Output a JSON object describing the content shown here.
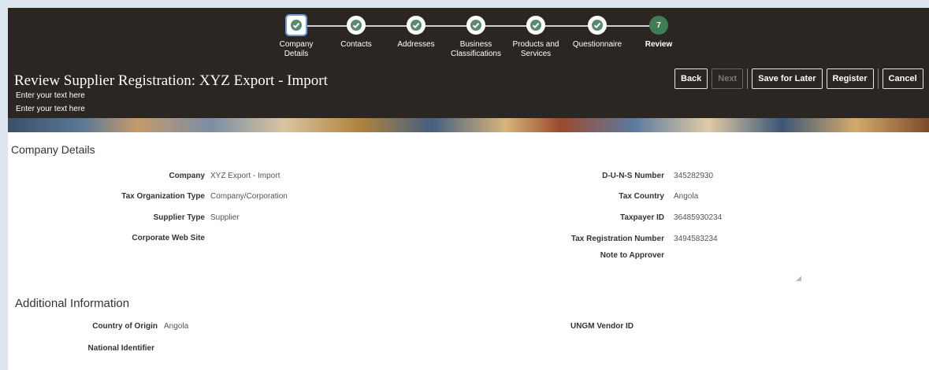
{
  "train": {
    "steps": [
      {
        "label": "Company\nDetails",
        "state": "done"
      },
      {
        "label": "Contacts",
        "state": "done"
      },
      {
        "label": "Addresses",
        "state": "done"
      },
      {
        "label": "Business\nClassifications",
        "state": "done"
      },
      {
        "label": "Products and\nServices",
        "state": "done"
      },
      {
        "label": "Questionnaire",
        "state": "done"
      },
      {
        "label": "Review",
        "state": "current",
        "number": "7"
      }
    ]
  },
  "header": {
    "title": "Review Supplier Registration: XYZ Export - Import",
    "line1": "Enter your text here",
    "line2": "Enter your text here"
  },
  "buttons": {
    "back": "Back",
    "next": "Next",
    "save_for_later": "Save for Later",
    "register": "Register",
    "cancel": "Cancel"
  },
  "company_details": {
    "section_title": "Company Details",
    "company_label": "Company",
    "company_value": "XYZ Export - Import",
    "tax_org_type_label": "Tax Organization Type",
    "tax_org_type_value": "Company/Corporation",
    "supplier_type_label": "Supplier Type",
    "supplier_type_value": "Supplier",
    "corporate_web_site_label": "Corporate Web Site",
    "duns_label": "D-U-N-S Number",
    "duns_value": "345282930",
    "tax_country_label": "Tax Country",
    "tax_country_value": "Angola",
    "taxpayer_id_label": "Taxpayer ID",
    "taxpayer_id_value": "36485930234",
    "tax_reg_number_label": "Tax Registration Number",
    "tax_reg_number_value": "3494583234",
    "note_to_approver_label": "Note to Approver"
  },
  "additional_info": {
    "section_title": "Additional Information",
    "country_of_origin_label": "Country of Origin",
    "country_of_origin_value": "Angola",
    "national_identifier_label": "National Identifier",
    "ungm_vendor_id_label": "UNGM Vendor ID"
  }
}
